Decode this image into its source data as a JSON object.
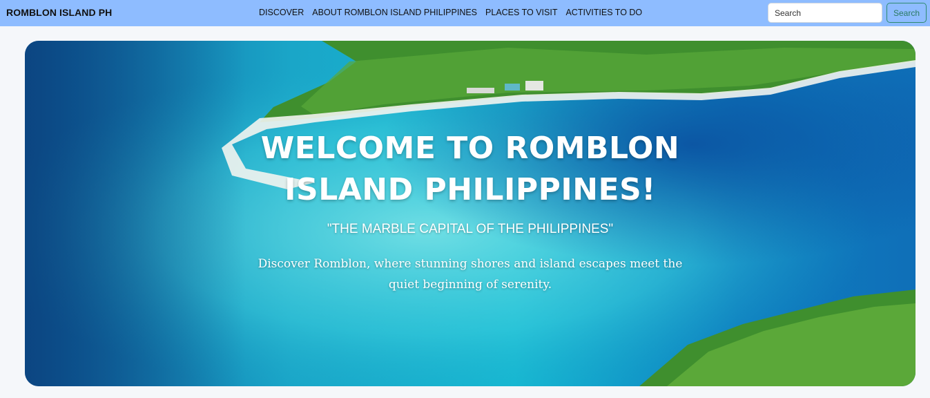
{
  "nav": {
    "brand": "ROMBLON ISLAND PH",
    "links": [
      {
        "label": "DISCOVER"
      },
      {
        "label": "ABOUT ROMBLON ISLAND PHILIPPINES"
      },
      {
        "label": "PLACES TO VISIT"
      },
      {
        "label": "ACTIVITIES TO DO"
      }
    ],
    "search_placeholder": "Search",
    "search_button": "Search"
  },
  "hero": {
    "title_line1": "WELCOME TO ROMBLON",
    "title_line2": "ISLAND PHILIPPINES!",
    "subtitle": "\"THE MARBLE CAPITAL OF THE PHILIPPINES\"",
    "description": "Discover Romblon, where stunning shores and island escapes meet the quiet beginning of serenity."
  },
  "colors": {
    "navbar": "#8ebcff",
    "search_button_border": "#2e8b6e",
    "page_background": "#f5f7fa"
  }
}
